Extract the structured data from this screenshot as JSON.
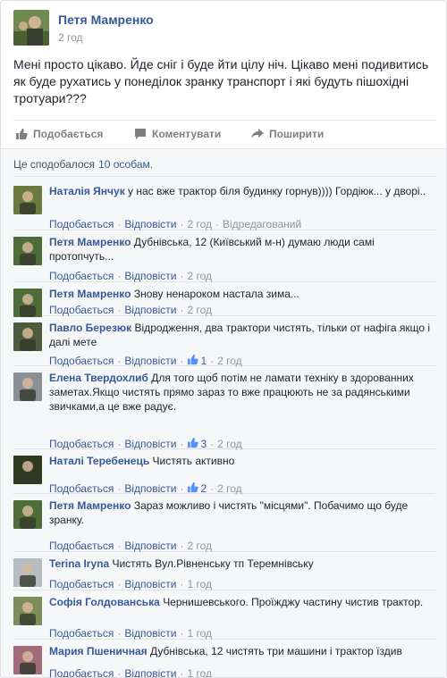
{
  "post": {
    "author": "Петя Мамренко",
    "time": "2 год",
    "text": "Мені просто цікаво. Йде сніг і буде йти цілу ніч. Цікаво мені подивитись як буде рухатись у понеділок зранку транспорт і які будуть пішохідні тротуари???"
  },
  "actions": {
    "like": "Подобається",
    "comment": "Коментувати",
    "share": "Поширити"
  },
  "likes": {
    "prefix": "Це сподобалося",
    "link": "10 особам",
    "suffix": "."
  },
  "comment_actions": {
    "like": "Подобається",
    "reply": "Відповісти"
  },
  "comments": [
    {
      "name": "Наталія Янчук",
      "text": "у нас вже трактор біля будинку горнув)))) Гордіюк... у дворі..",
      "time": "2 год",
      "likes": "",
      "edited": "Відредагований",
      "avatar_color": "#6b7a3e"
    },
    {
      "name": "Петя Мамренко",
      "text": "Дубнівська, 12 (Київський м-н) думаю люди самі протопчуть...",
      "time": "2 год",
      "likes": "",
      "edited": "",
      "avatar_color": "#4f6d3a"
    },
    {
      "name": "Петя Мамренко",
      "text": "Знову ненароком настала зима...",
      "time": "2 год",
      "likes": "",
      "edited": "",
      "avatar_color": "#4f6d3a"
    },
    {
      "name": "Павло Березюк",
      "text": "Відродження, два трактори чистять, тільки от нафіга якщо і далі мете",
      "time": "2 год",
      "likes": "1",
      "edited": "",
      "avatar_color": "#4d5a3c"
    },
    {
      "name": "Елена Твердохлиб",
      "text": "Для того щоб потім не ламати техніку в здорованних заметах.Якщо чистять прямо зараз то вже працюють не за радянськими звичками,а це вже радує.",
      "time": "2 год",
      "likes": "3",
      "edited": "",
      "avatar_color": "#8a8f95"
    },
    {
      "name": "Наталі Теребенець",
      "text": "Чистять активно",
      "time": "2 год",
      "likes": "2",
      "edited": "",
      "avatar_color": "#2d3a20"
    },
    {
      "name": "Петя Мамренко",
      "text": "Зараз можливо і чистять \"місцями\". Побачимо що буде зранку.",
      "time": "2 год",
      "likes": "",
      "edited": "",
      "avatar_color": "#4f6d3a"
    },
    {
      "name": "Terina Iryna",
      "text": "Чистять Вул.Рівненську тп Теремнівську",
      "time": "1 год",
      "likes": "",
      "edited": "",
      "avatar_color": "#b7bcc2"
    },
    {
      "name": "Софія Голдованська",
      "text": "Чернишевського. Проїжджу частину чистив трактор.",
      "time": "1 год",
      "likes": "",
      "edited": "",
      "avatar_color": "#7d8c5a"
    },
    {
      "name": "Мария Пшеничная",
      "text": "Дубнівська, 12 чистять три машини і трактор їздив",
      "time": "1 год",
      "likes": "",
      "edited": "",
      "avatar_color": "#a26a7a"
    }
  ],
  "colors": {
    "link": "#365899",
    "meta": "#90949c",
    "text": "#1d2129",
    "comments_bg": "#f6f7f9",
    "like_icon": "#5890ff"
  }
}
